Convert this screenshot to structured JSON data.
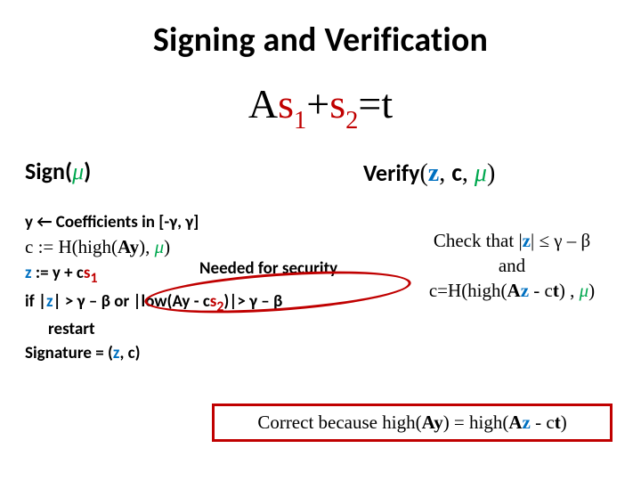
{
  "slide": {
    "title": "Signing and Verification",
    "equation": {
      "A": "A",
      "s1": "s",
      "sub1": "1",
      "plus": "+",
      "s2": "s",
      "sub2": "2",
      "eq": "=",
      "t": "t"
    },
    "headers": {
      "sign_label": "Sign(",
      "sign_mu": "μ",
      "sign_close": ")",
      "verify_label": "Verify",
      "verify_open": "(",
      "verify_z": "z",
      "verify_comma1": ", ",
      "verify_c": "c",
      "verify_comma2": ", ",
      "verify_mu": "μ",
      "verify_close": ")"
    },
    "sign": {
      "l1_prefix": "y",
      "l1_arrow": " ← Coefficients in [-γ, γ]",
      "l2_part1": "c",
      "l2_part2": " := H(high(",
      "l2_part3": "A",
      "l2_part4": "y",
      "l2_part5": "), ",
      "l2_mu": "μ",
      "l2_part6": ")",
      "l3_part1": "z",
      "l3_part2": " := ",
      "l3_part3": "y",
      "l3_part4": " + c",
      "l3_s": "s",
      "l3_sub": "1",
      "l4_part1": "if |",
      "l4_z": "z",
      "l4_part2": "| > γ – β or  |low(",
      "l4_A": "A",
      "l4_y": "y",
      "l4_part3": " - c",
      "l4_s2": "s",
      "l4_sub2": "2",
      "l4_part4": ")|> γ – β",
      "l5": "restart",
      "l6_part1": "Signature =  (",
      "l6_z": "z",
      "l6_part2": ", c)",
      "needed": "Needed for security"
    },
    "verify": {
      "check1_part1": "Check that |",
      "check1_z": "z",
      "check1_part2": "| ≤ γ – β",
      "and": "and",
      "check2_part1": "c=H(high(",
      "check2_A": "A",
      "check2_z": "z",
      "check2_part2": " - c",
      "check2_t": "t",
      "check2_part3": ") , ",
      "check2_mu": "μ",
      "check2_part4": ")"
    },
    "correct": {
      "part1": "Correct because high(",
      "A1": "A",
      "y": "y",
      "part2": ") = high(",
      "A2": "A",
      "z": "z",
      "part3": " - c",
      "t": "t",
      "part4": ")"
    }
  }
}
